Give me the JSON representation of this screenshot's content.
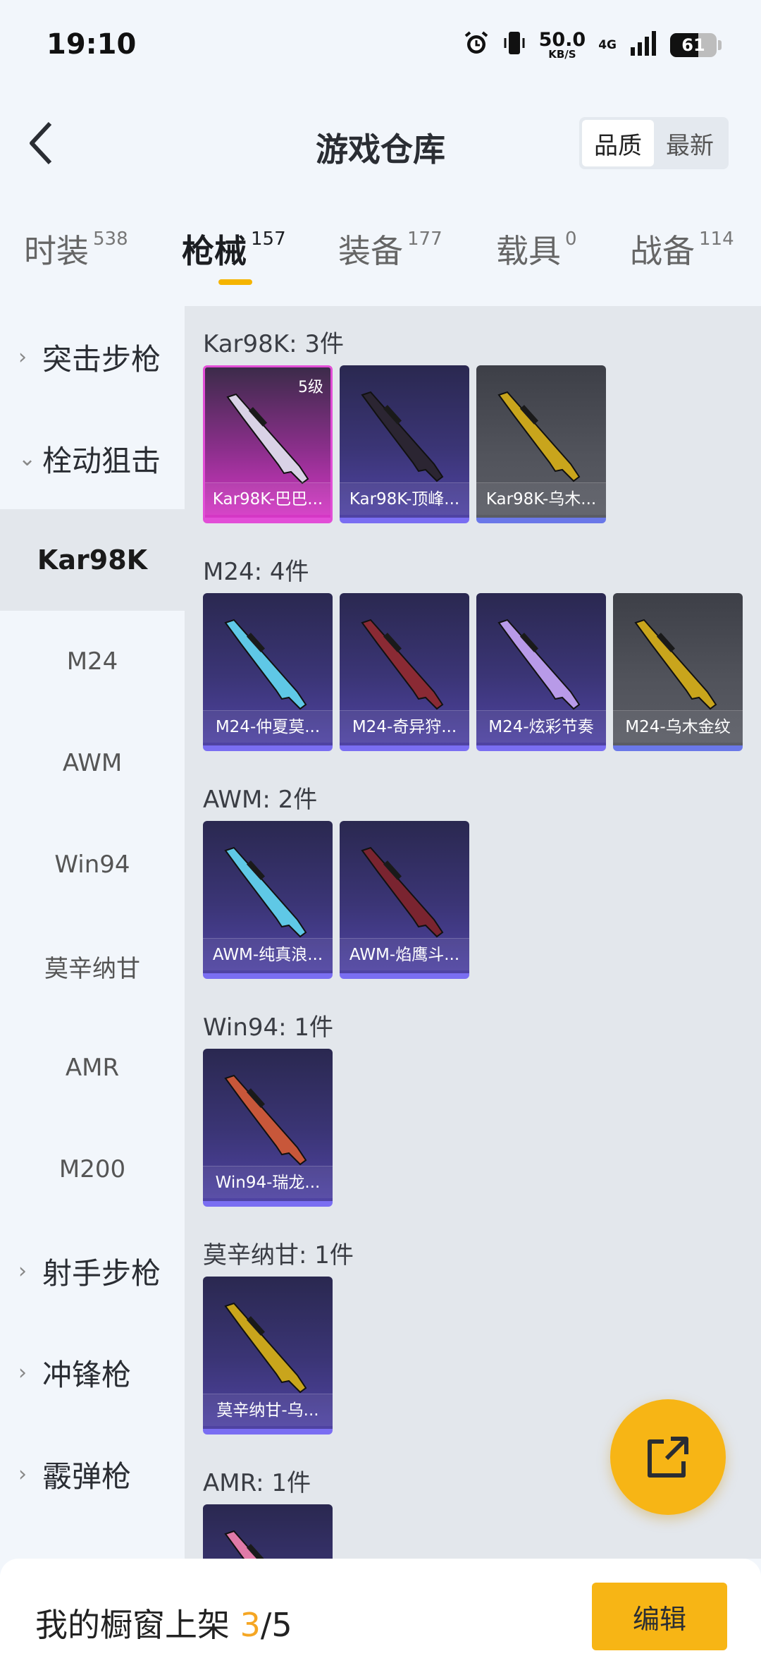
{
  "status_bar": {
    "time": "19:10",
    "net_speed_value": "50.0",
    "net_speed_unit": "KB/S",
    "network": "4G",
    "battery": "61",
    "icons": [
      "alarm-icon",
      "vibrate-icon",
      "signal-icon",
      "battery-icon"
    ]
  },
  "header": {
    "title": "游戏仓库",
    "back_icon": "chevron-left-icon",
    "sort_options": [
      {
        "label": "品质",
        "active": true
      },
      {
        "label": "最新",
        "active": false
      }
    ]
  },
  "tabs": [
    {
      "label": "时装",
      "count": "538",
      "active": false
    },
    {
      "label": "枪械",
      "count": "157",
      "active": true
    },
    {
      "label": "装备",
      "count": "177",
      "active": false
    },
    {
      "label": "载具",
      "count": "0",
      "active": false
    },
    {
      "label": "战备",
      "count": "114",
      "active": false
    }
  ],
  "sidebar": {
    "items": [
      {
        "type": "category",
        "label": "突击步枪",
        "expanded": false
      },
      {
        "type": "category",
        "label": "栓动狙击",
        "expanded": true
      },
      {
        "type": "sub",
        "label": "Kar98K",
        "active": true
      },
      {
        "type": "sub",
        "label": "M24",
        "active": false
      },
      {
        "type": "sub",
        "label": "AWM",
        "active": false
      },
      {
        "type": "sub",
        "label": "Win94",
        "active": false
      },
      {
        "type": "sub",
        "label": "莫辛纳甘",
        "active": false
      },
      {
        "type": "sub",
        "label": "AMR",
        "active": false
      },
      {
        "type": "sub",
        "label": "M200",
        "active": false
      },
      {
        "type": "category",
        "label": "射手步枪",
        "expanded": false
      },
      {
        "type": "category",
        "label": "冲锋枪",
        "expanded": false
      },
      {
        "type": "category",
        "label": "霰弹枪",
        "expanded": false
      }
    ]
  },
  "groups": [
    {
      "title": "Kar98K: 3件",
      "items": [
        {
          "name": "Kar98K-巴巴...",
          "tier": "pink",
          "level": "5级",
          "gun_color": "#d9d2e6"
        },
        {
          "name": "Kar98K-顶峰...",
          "tier": "purple",
          "level": "",
          "gun_color": "#2b2532"
        },
        {
          "name": "Kar98K-乌木...",
          "tier": "gray",
          "level": "",
          "gun_color": "#c9a51c"
        }
      ]
    },
    {
      "title": "M24: 4件",
      "items": [
        {
          "name": "M24-仲夏莫...",
          "tier": "purple",
          "level": "",
          "gun_color": "#5fc8e6"
        },
        {
          "name": "M24-奇异狩...",
          "tier": "purple",
          "level": "",
          "gun_color": "#8a2a34"
        },
        {
          "name": "M24-炫彩节奏",
          "tier": "purple",
          "level": "",
          "gun_color": "#b89ae8"
        },
        {
          "name": "M24-乌木金纹",
          "tier": "gray",
          "level": "",
          "gun_color": "#c9a51c"
        }
      ]
    },
    {
      "title": "AWM: 2件",
      "items": [
        {
          "name": "AWM-纯真浪...",
          "tier": "purple",
          "level": "",
          "gun_color": "#5fc8e6"
        },
        {
          "name": "AWM-焰鹰斗...",
          "tier": "purple",
          "level": "",
          "gun_color": "#7a2430"
        }
      ]
    },
    {
      "title": "Win94: 1件",
      "items": [
        {
          "name": "Win94-瑞龙...",
          "tier": "purple",
          "level": "",
          "gun_color": "#c8573a"
        }
      ]
    },
    {
      "title": "莫辛纳甘: 1件",
      "items": [
        {
          "name": "莫辛纳甘-乌...",
          "tier": "purple",
          "level": "",
          "gun_color": "#c9a51c"
        }
      ]
    },
    {
      "title": "AMR: 1件",
      "items": [
        {
          "name": "",
          "tier": "purple",
          "level": "",
          "gun_color": "#e07aa8"
        }
      ]
    }
  ],
  "fab": {
    "icon": "share-icon"
  },
  "bottom_bar": {
    "label": "我的橱窗上架 ",
    "current": "3",
    "total": "/5",
    "edit_label": "编辑"
  },
  "colors": {
    "accent": "#f7b515",
    "pink_tier": "#e24ed7",
    "purple_tier": "#7a6ef2",
    "gray_tier": "#6a78e8"
  }
}
